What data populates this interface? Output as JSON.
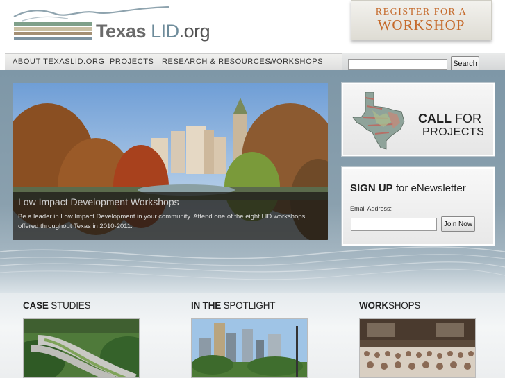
{
  "header": {
    "logo_texas": "Texas",
    "logo_lid": "LID",
    "logo_org": ".org",
    "register_line1": "REGISTER FOR A",
    "register_line2": "WORKSHOP"
  },
  "nav": {
    "items": [
      "ABOUT TEXASLID.ORG",
      "PROJECTS",
      "RESEARCH & RESOURCES",
      "WORKSHOPS"
    ]
  },
  "search": {
    "value": "",
    "button_label": "Search"
  },
  "hero": {
    "title": "Low Impact Development Workshops",
    "text": "Be a leader in Low Impact Development in your community. Attend one of the eight LID workshops offered throughout Texas in 2010-2011."
  },
  "call_for_projects": {
    "call": "CALL",
    "for": "FOR",
    "projects": "PROJECTS"
  },
  "newsletter": {
    "title_bold": "SIGN UP",
    "title_rest": " for eNewsletter",
    "email_label": "Email Address:",
    "email_value": "",
    "button_label": "Join Now"
  },
  "columns": [
    {
      "bold": "CASE",
      "rest": " STUDIES"
    },
    {
      "bold": "IN THE",
      "rest": " SPOTLIGHT"
    },
    {
      "bold": "WORK",
      "rest": "SHOPS"
    }
  ],
  "colors": {
    "accent_orange": "#c56a2b",
    "band_blue": "#7e97a7",
    "logo_blue": "#6d8b9a"
  }
}
